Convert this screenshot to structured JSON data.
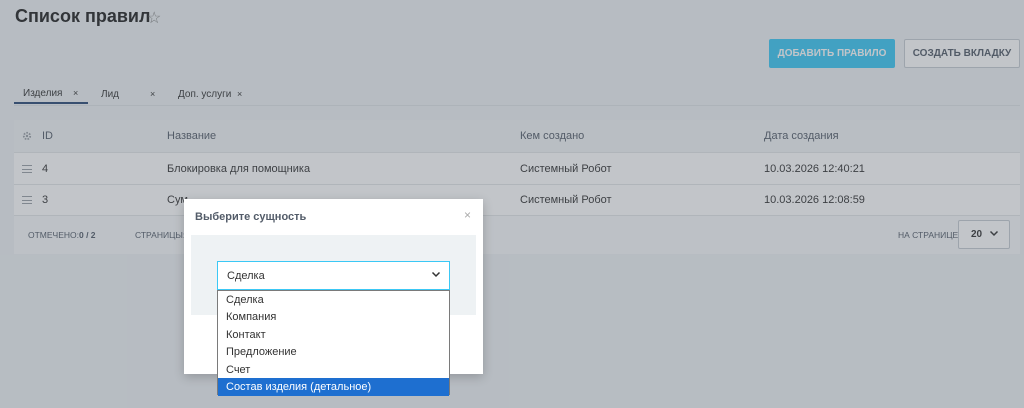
{
  "page": {
    "title": "Список правил",
    "star_icon": "☆"
  },
  "toolbar": {
    "add_rule": "ДОБАВИТЬ ПРАВИЛО",
    "create_tab": "СОЗДАТЬ ВКЛАДКУ"
  },
  "tabs": [
    {
      "label": "Изделия",
      "close": "×",
      "active": true
    },
    {
      "label": "Лид",
      "close": "×",
      "active": false
    },
    {
      "label": "Доп. услуги",
      "close": "×",
      "active": false
    }
  ],
  "grid": {
    "columns": [
      "ID",
      "Название",
      "Кем создано",
      "Дата создания"
    ],
    "rows": [
      {
        "id": "4",
        "name": "Блокировка для помощника",
        "created_by": "Системный Робот",
        "created_at": "10.03.2026 12:40:21"
      },
      {
        "id": "3",
        "name": "Сум... ",
        "created_by": "Системный Робот",
        "created_at": "10.03.2026 12:08:59"
      }
    ],
    "footer": {
      "selected_label": "ОТМЕЧЕНО:",
      "selected_value": "0 / 2",
      "pages_label": "СТРАНИЦЫ:",
      "per_page_label": "НА СТРАНИЦЕ:",
      "per_page_value": "20"
    }
  },
  "dialog": {
    "title": "Выберите сущность",
    "close": "×",
    "select_value": "Сделка",
    "options": [
      "Сделка",
      "Компания",
      "Контакт",
      "Предложение",
      "Счет",
      "Состав изделия (детальное)"
    ],
    "highlighted_option_index": 5
  },
  "colors": {
    "primary": "#3bc8f5",
    "highlight": "#1e6fd0",
    "overlay": "rgba(80,90,100,0.35)"
  }
}
